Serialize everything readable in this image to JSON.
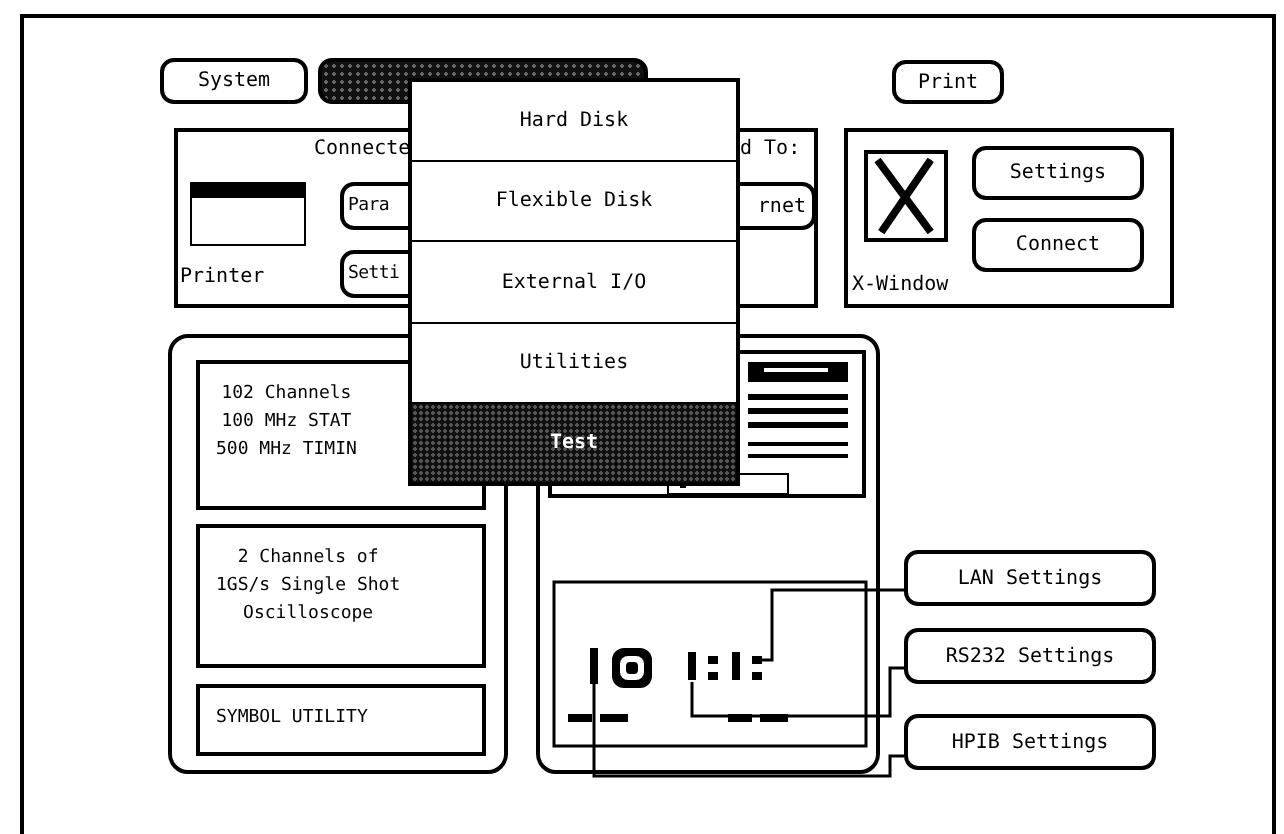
{
  "mode_tabs": [
    {
      "label": "System",
      "selected": false
    },
    {
      "selected": true
    }
  ],
  "print_button": "Print",
  "connected_to": {
    "title_parts": [
      "Connecte",
      "d To:"
    ],
    "printer_label": "Printer",
    "buttons": [
      "Para",
      "Setti",
      "rnet"
    ]
  },
  "x_window": {
    "label": "X-Window",
    "buttons": [
      "Settings",
      "Connect"
    ]
  },
  "modules": [
    {
      "lines": [
        "102 Channels",
        "100 MHz STAT",
        "500 MHz TIMIN"
      ]
    },
    {
      "lines": [
        "2 Channels of",
        "1GS/s Single Shot",
        "Oscilloscope"
      ]
    },
    {
      "lines": [
        "SYMBOL UTILITY"
      ]
    }
  ],
  "port_buttons": [
    "LAN Settings",
    "RS232 Settings",
    "HPIB Settings"
  ],
  "menu": [
    {
      "label": "Hard Disk",
      "selected": false
    },
    {
      "label": "Flexible Disk",
      "selected": false
    },
    {
      "label": "External I/O",
      "selected": false
    },
    {
      "label": "Utilities",
      "selected": false
    },
    {
      "label": "Test",
      "selected": true
    }
  ]
}
